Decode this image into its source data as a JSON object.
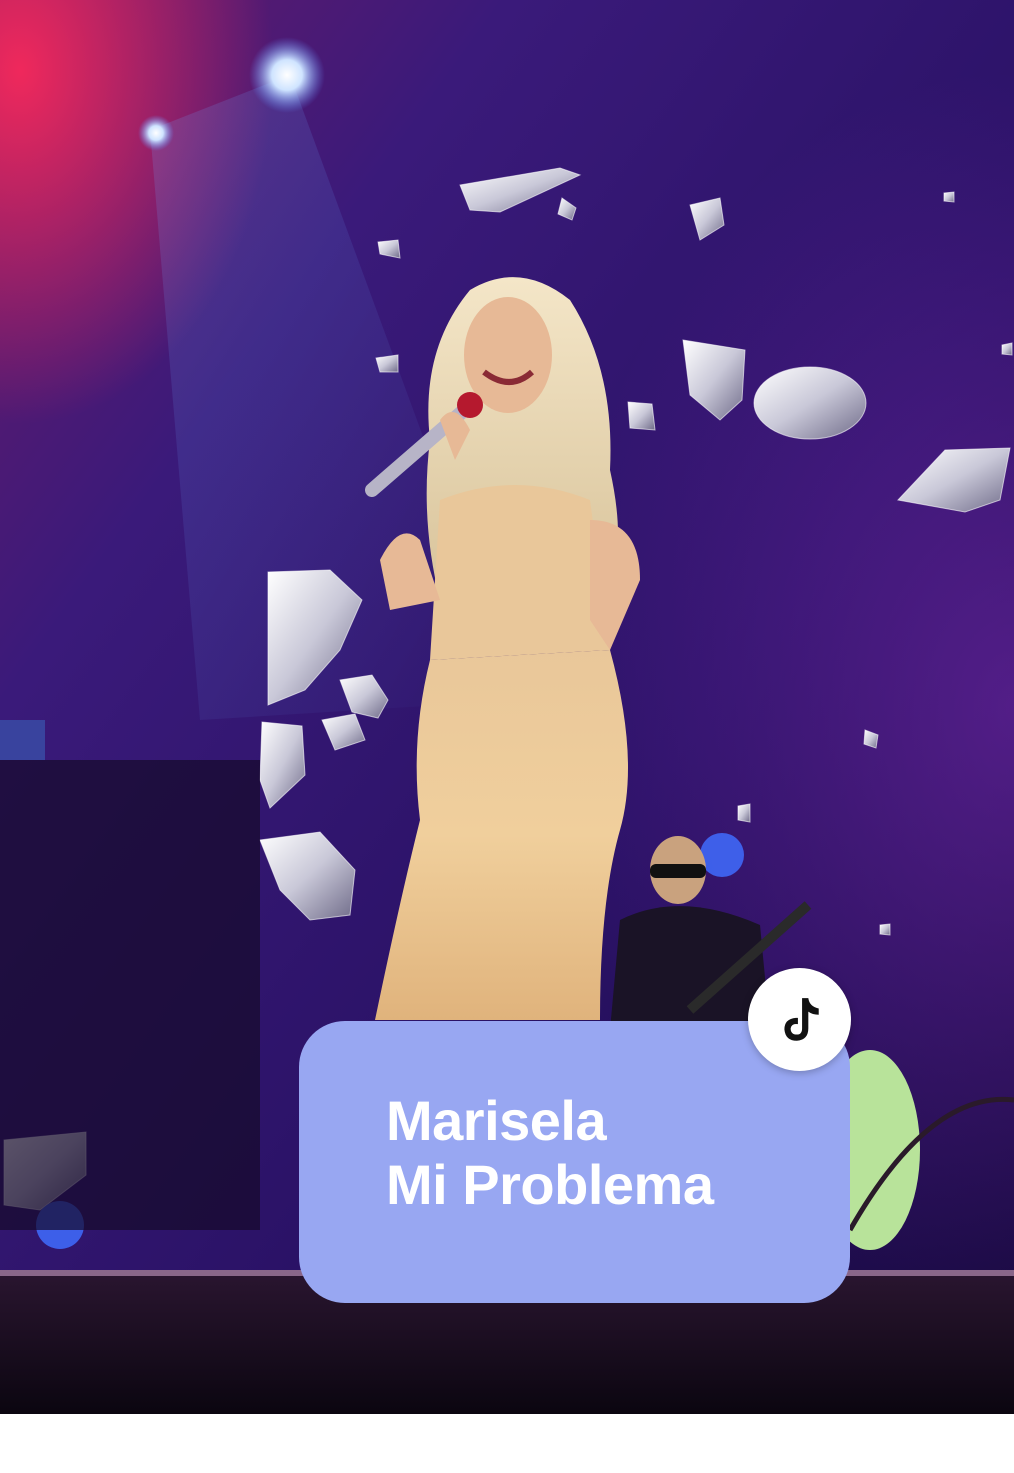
{
  "caption": {
    "line1": "Marisela",
    "line2": "Mi Problema"
  },
  "badge": {
    "icon": "tiktok-logo-icon"
  },
  "colors": {
    "caption_background": "#98a7f2",
    "caption_text": "#ffffff",
    "stage_background": "#1c0a44",
    "badge_background": "#ffffff"
  }
}
